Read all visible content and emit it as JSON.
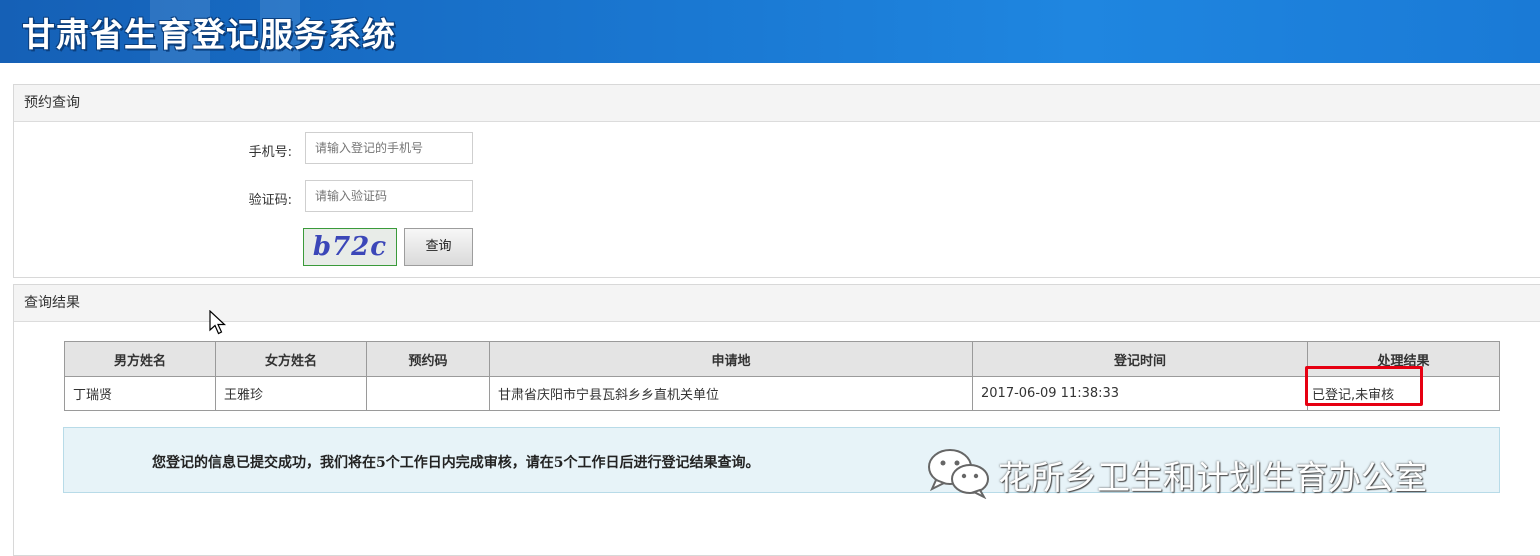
{
  "header": {
    "title": "甘肃省生育登记服务系统"
  },
  "query_panel": {
    "title": "预约查询",
    "phone_label": "手机号:",
    "phone_placeholder": "请输入登记的手机号",
    "captcha_label": "验证码:",
    "captcha_placeholder": "请输入验证码",
    "captcha_text": "b72c",
    "submit_label": "查询"
  },
  "result_panel": {
    "title": "查询结果",
    "columns": [
      "男方姓名",
      "女方姓名",
      "预约码",
      "申请地",
      "登记时间",
      "处理结果"
    ],
    "rows": [
      {
        "male_name": "丁瑞贤",
        "female_name": "王雅珍",
        "code": "",
        "location": "甘肃省庆阳市宁县瓦斜乡乡直机关单位",
        "time": "2017-06-09 11:38:33",
        "status": "已登记,未审核"
      }
    ],
    "notice": "您登记的信息已提交成功，我们将在5个工作日内完成审核，请在5个工作日后进行登记结果查询。"
  },
  "watermark": {
    "text": "花所乡卫生和计划生育办公室",
    "icon": "wechat-icon"
  },
  "colors": {
    "header_blue": "#1a78d2",
    "highlight_red": "#e60012",
    "notice_bg": "#e7f3f8"
  }
}
